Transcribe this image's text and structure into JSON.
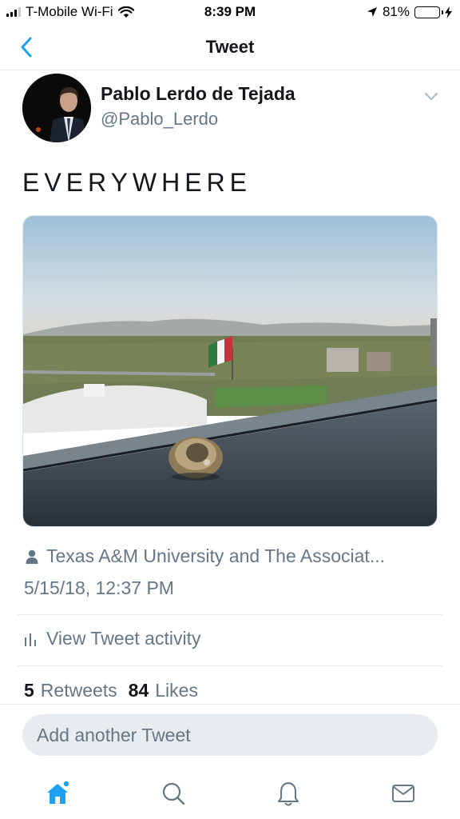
{
  "status_bar": {
    "carrier": "T-Mobile Wi-Fi",
    "time": "8:39 PM",
    "battery_percent": "81%",
    "battery_level": 0.81,
    "icons": [
      "signal-icon",
      "wifi-icon",
      "location-arrow-icon",
      "battery-icon",
      "charging-bolt-icon"
    ]
  },
  "nav": {
    "title": "Tweet",
    "back_icon": "chevron-left-icon"
  },
  "tweet": {
    "display_name": "Pablo Lerdo de Tejada",
    "handle": "@Pablo_Lerdo",
    "text": "EVERYWHERE",
    "location": "Texas A&M University and The Associat...",
    "timestamp": "5/15/18, 12:37 PM",
    "activity_label": "View Tweet activity",
    "retweets_count": "5",
    "retweets_label": "Retweets",
    "likes_count": "84",
    "likes_label": "Likes"
  },
  "reply": {
    "placeholder": "Add another Tweet"
  },
  "tab_bar": {
    "items": [
      "home-icon",
      "search-icon",
      "notifications-icon",
      "messages-icon"
    ],
    "active": "home-icon"
  },
  "colors": {
    "accent": "#1da1f2",
    "secondary_text": "#657786",
    "primary_text": "#14171a",
    "battery_fill": "#4cd964"
  }
}
